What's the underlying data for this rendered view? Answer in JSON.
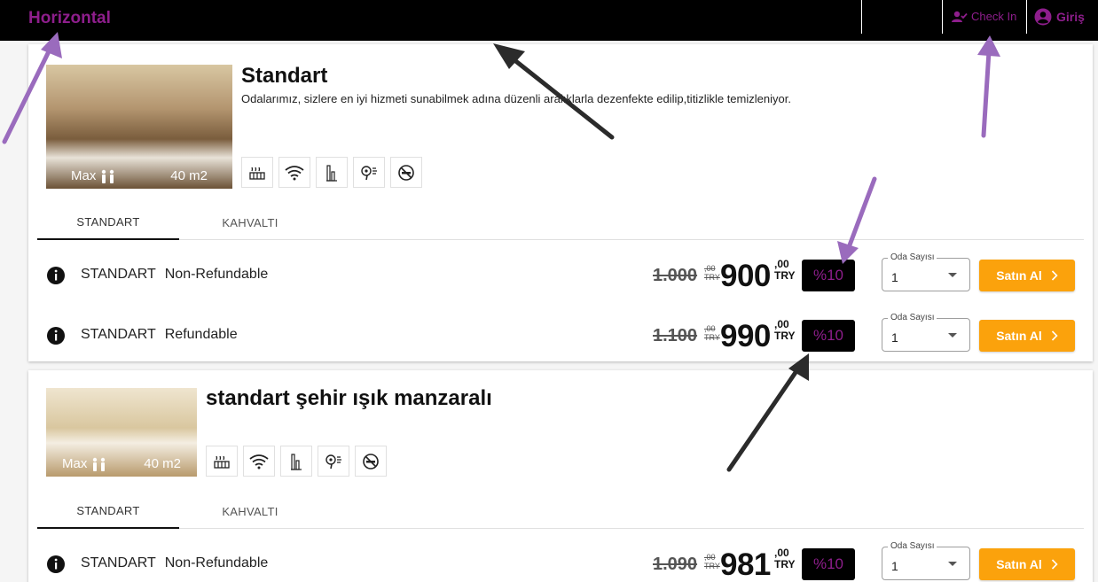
{
  "header": {
    "brand": "Horizontal",
    "checkin_label": "Check In",
    "login_label": "Giriş"
  },
  "rooms": [
    {
      "title": "Standart",
      "description": "Odalarımız, sizlere en iyi hizmeti sunabilmek adına düzenli aralıklarla dezenfekte edilip,titizlikle temizleniyor.",
      "max_label": "Max",
      "area": "40 m2",
      "tabs": [
        "STANDART",
        "KAHVALTI"
      ],
      "rates": [
        {
          "type": "STANDART",
          "policy": "Non-Refundable",
          "old_price": "1.000",
          "old_dec": ",00",
          "old_cur": "TRY",
          "new_price": "900",
          "new_dec": ",00",
          "new_cur": "TRY",
          "discount": "%10",
          "select_label": "Oda Sayısı",
          "select_value": "1",
          "buy_label": "Satın Al"
        },
        {
          "type": "STANDART",
          "policy": "Refundable",
          "old_price": "1.100",
          "old_dec": ",00",
          "old_cur": "TRY",
          "new_price": "990",
          "new_dec": ",00",
          "new_cur": "TRY",
          "discount": "%10",
          "select_label": "Oda Sayısı",
          "select_value": "1",
          "buy_label": "Satın Al"
        }
      ]
    },
    {
      "title": "standart şehir ışık manzaralı",
      "max_label": "Max",
      "area": "40 m2",
      "tabs": [
        "STANDART",
        "KAHVALTI"
      ],
      "rates": [
        {
          "type": "STANDART",
          "policy": "Non-Refundable",
          "old_price": "1.090",
          "old_dec": ",00",
          "old_cur": "TRY",
          "new_price": "981",
          "new_dec": ",00",
          "new_cur": "TRY",
          "discount": "%10",
          "select_label": "Oda Sayısı",
          "select_value": "1",
          "buy_label": "Satın Al"
        }
      ]
    }
  ],
  "amenity_icons": [
    "heating-icon",
    "wifi-icon",
    "minibar-icon",
    "hairdryer-icon",
    "no-smoking-icon"
  ],
  "colors": {
    "brand": "#8e1e8c",
    "topbar": "#000000",
    "buy_button": "#fba20c",
    "discount_bg": "#000000",
    "annotation_purple": "#9a6bbd",
    "annotation_dark": "#2b2b2b"
  }
}
